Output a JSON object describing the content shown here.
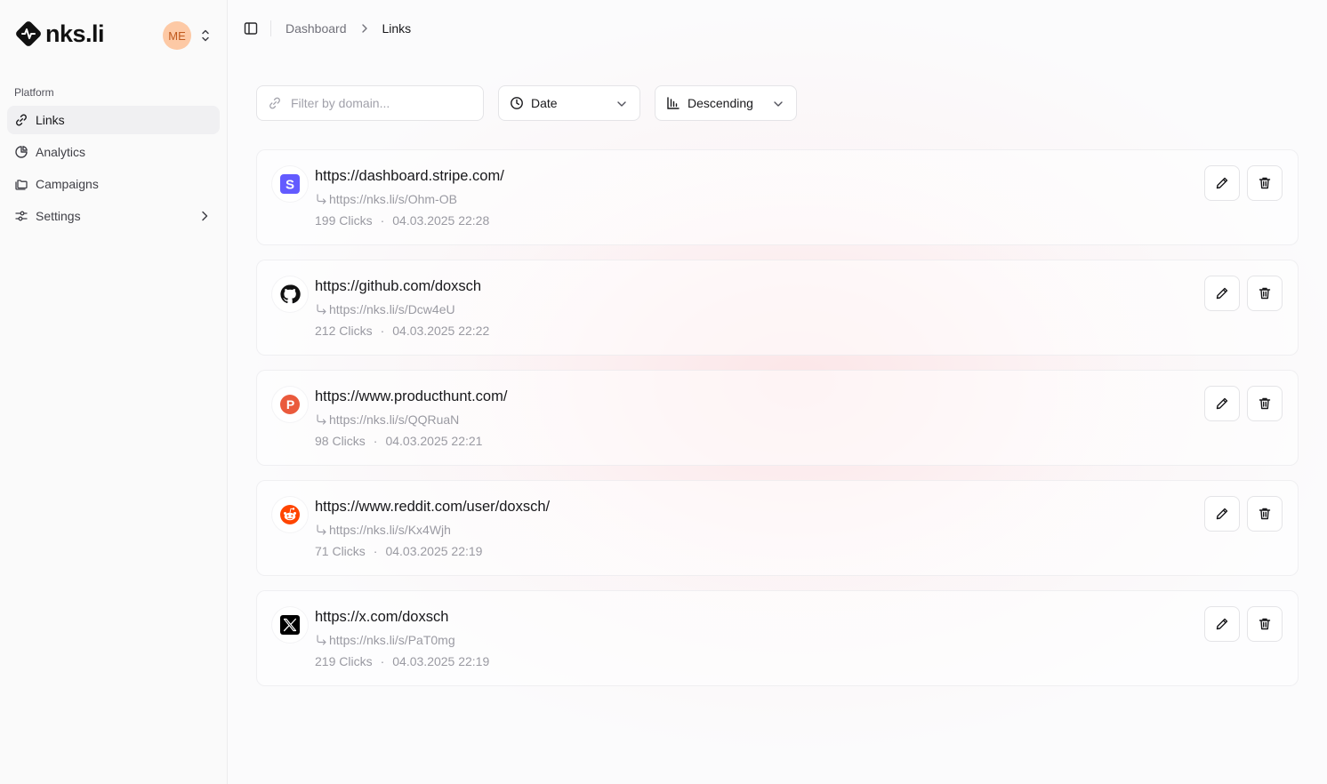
{
  "brand": {
    "name": "nks.li"
  },
  "user": {
    "initials": "ME"
  },
  "sidebar": {
    "section_label": "Platform",
    "items": [
      {
        "label": "Links",
        "icon": "link-icon",
        "active": true
      },
      {
        "label": "Analytics",
        "icon": "pie-chart-icon"
      },
      {
        "label": "Campaigns",
        "icon": "folders-icon"
      },
      {
        "label": "Settings",
        "icon": "sliders-icon",
        "has_submenu": true
      }
    ]
  },
  "breadcrumb": {
    "parent": "Dashboard",
    "current": "Links"
  },
  "filters": {
    "domain_placeholder": "Filter by domain...",
    "sort_field": "Date",
    "sort_order": "Descending"
  },
  "links": [
    {
      "destination": "https://dashboard.stripe.com/",
      "short": "https://nks.li/s/Ohm-OB",
      "clicks": "199 Clicks",
      "date": "04.03.2025 22:28",
      "favicon": "stripe-icon"
    },
    {
      "destination": "https://github.com/doxsch",
      "short": "https://nks.li/s/Dcw4eU",
      "clicks": "212 Clicks",
      "date": "04.03.2025 22:22",
      "favicon": "github-icon"
    },
    {
      "destination": "https://www.producthunt.com/",
      "short": "https://nks.li/s/QQRuaN",
      "clicks": "98 Clicks",
      "date": "04.03.2025 22:21",
      "favicon": "producthunt-icon"
    },
    {
      "destination": "https://www.reddit.com/user/doxsch/",
      "short": "https://nks.li/s/Kx4Wjh",
      "clicks": "71 Clicks",
      "date": "04.03.2025 22:19",
      "favicon": "reddit-icon"
    },
    {
      "destination": "https://x.com/doxsch",
      "short": "https://nks.li/s/PaT0mg",
      "clicks": "219 Clicks",
      "date": "04.03.2025 22:19",
      "favicon": "x-icon"
    }
  ],
  "meta_separator": "·",
  "colors": {
    "accent": "#18181b",
    "stripe": "#635bff",
    "producthunt": "#ea5a3c",
    "reddit": "#ff4500",
    "avatar_bg": "#fdc9a5"
  }
}
